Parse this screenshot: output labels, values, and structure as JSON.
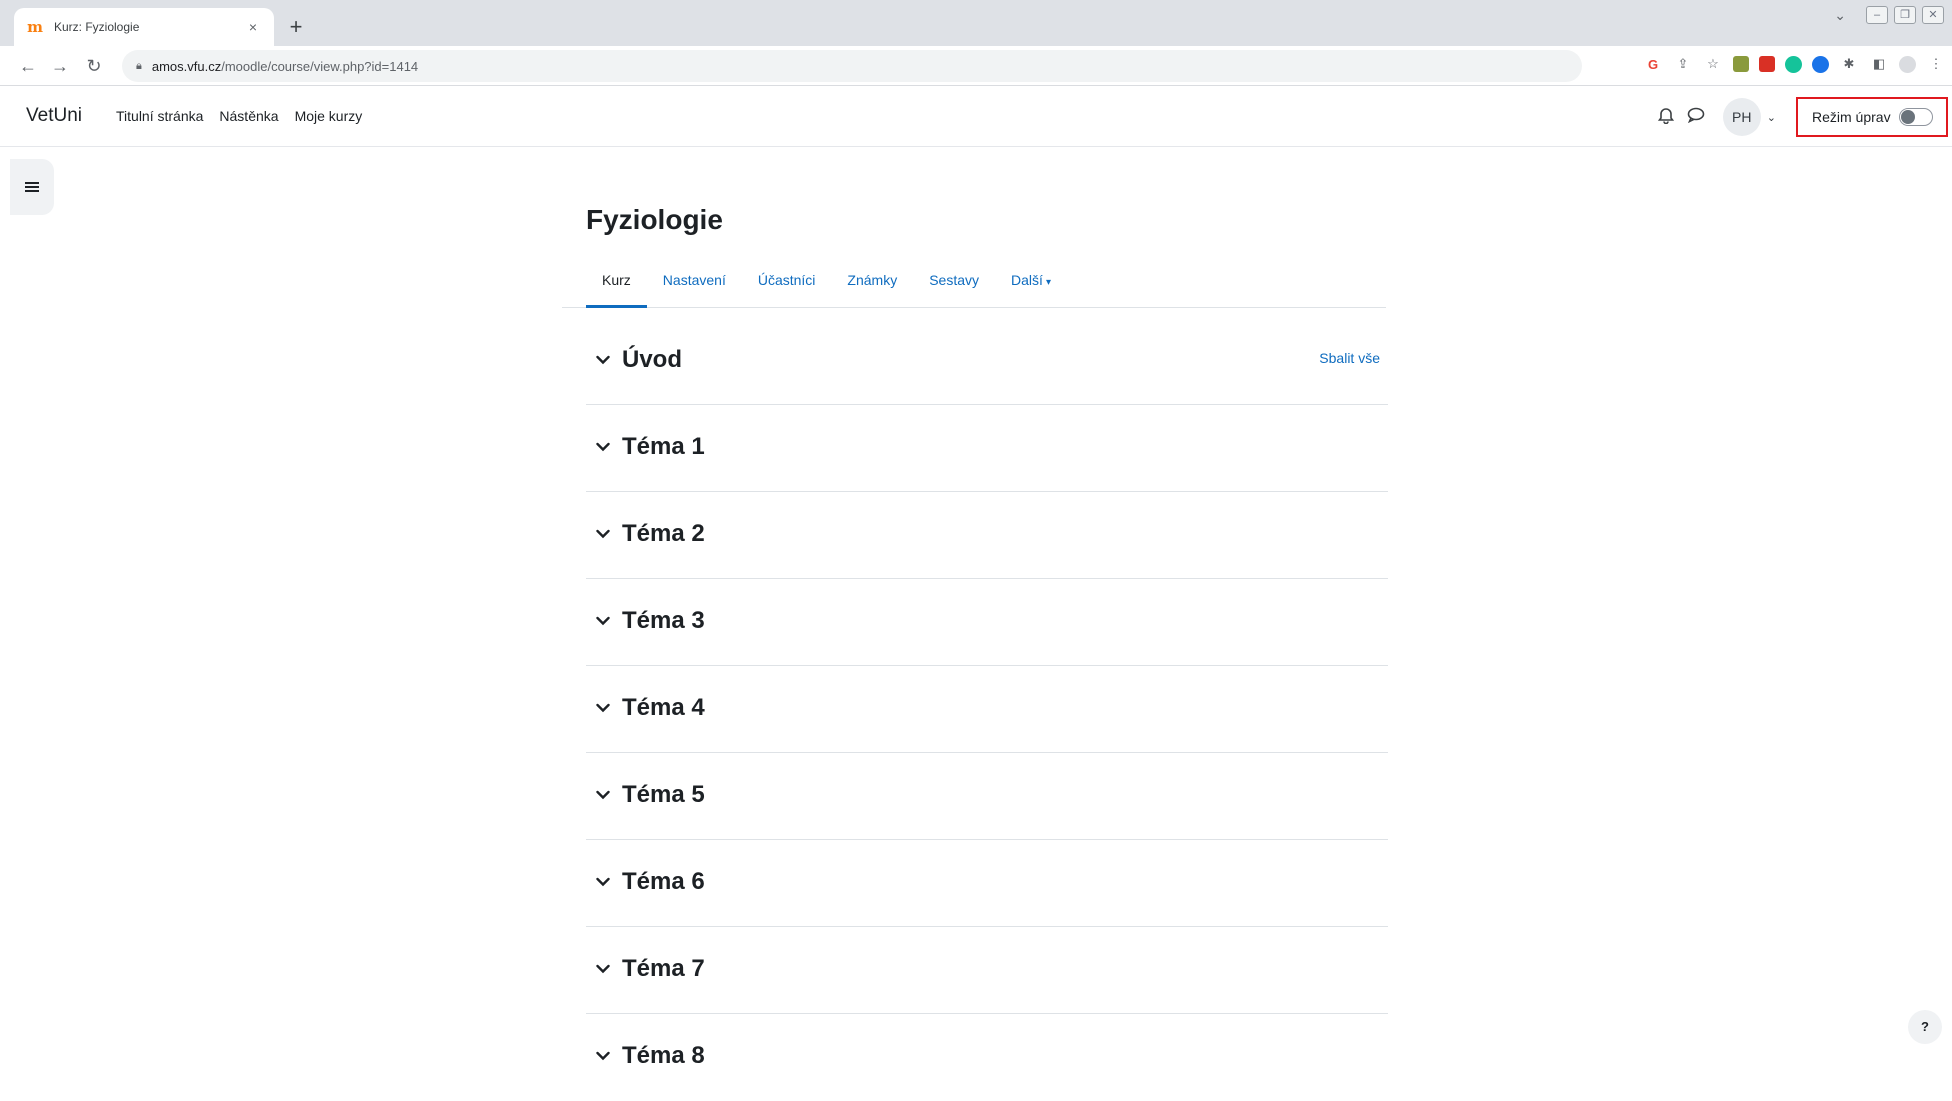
{
  "browser": {
    "tab_title": "Kurz: Fyziologie",
    "tab_close": "×",
    "new_tab": "+",
    "url_host": "amos.vfu.cz",
    "url_path": "/moodle/course/view.php?id=1414",
    "tabsearch": "⌄"
  },
  "navbar": {
    "brand": "VetUni",
    "links": [
      "Titulní stránka",
      "Nástěnka",
      "Moje kurzy"
    ],
    "avatar_initials": "PH",
    "edit_mode_label": "Režim úprav"
  },
  "course": {
    "title": "Fyziologie",
    "tabs": [
      "Kurz",
      "Nastavení",
      "Účastníci",
      "Známky",
      "Sestavy",
      "Další"
    ],
    "active_tab": "Kurz",
    "collapse_all": "Sbalit vše",
    "sections": [
      "Úvod",
      "Téma 1",
      "Téma 2",
      "Téma 3",
      "Téma 4",
      "Téma 5",
      "Téma 6",
      "Téma 7",
      "Téma 8"
    ]
  },
  "help": "?",
  "colors": {
    "accent": "#0f6cbf",
    "highlight_box": "#e0191f"
  }
}
